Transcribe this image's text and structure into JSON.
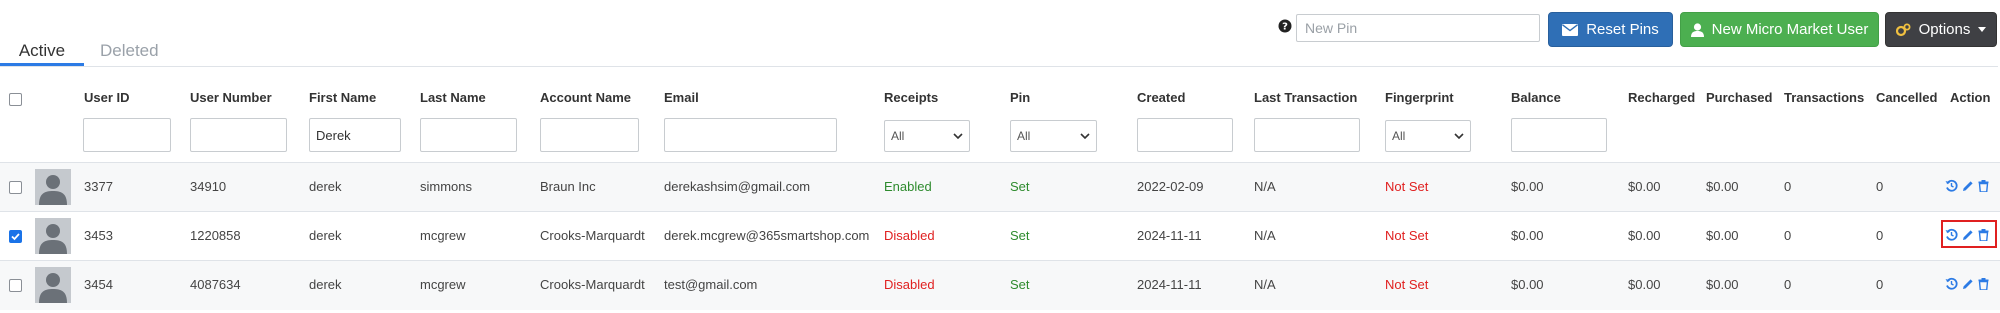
{
  "tabs": {
    "active": "Active",
    "deleted": "Deleted"
  },
  "toolbar": {
    "pin_placeholder": "New Pin",
    "reset_pins": "Reset Pins",
    "new_user": "New Micro Market User",
    "options": "Options"
  },
  "columns": {
    "user_id": "User ID",
    "user_number": "User Number",
    "first_name": "First Name",
    "last_name": "Last Name",
    "account_name": "Account Name",
    "email": "Email",
    "receipts": "Receipts",
    "pin": "Pin",
    "created": "Created",
    "last_transaction": "Last Transaction",
    "fingerprint": "Fingerprint",
    "balance": "Balance",
    "recharged": "Recharged",
    "purchased": "Purchased",
    "transactions": "Transactions",
    "cancelled": "Cancelled",
    "action": "Action"
  },
  "filters": {
    "first_name_value": "Derek",
    "receipts_select": "All",
    "pin_select": "All",
    "fingerprint_select": "All"
  },
  "rows": [
    {
      "checked": false,
      "user_id": "3377",
      "user_number": "34910",
      "first_name": "derek",
      "last_name": "simmons",
      "account_name": "Braun Inc",
      "email": "derekashsim@gmail.com",
      "receipts": "Enabled",
      "pin": "Set",
      "created": "2022-02-09",
      "last_transaction": "N/A",
      "fingerprint": "Not Set",
      "balance": "$0.00",
      "recharged": "$0.00",
      "purchased": "$0.00",
      "transactions": "0",
      "cancelled": "0"
    },
    {
      "checked": true,
      "user_id": "3453",
      "user_number": "1220858",
      "first_name": "derek",
      "last_name": "mcgrew",
      "account_name": "Crooks-Marquardt",
      "email": "derek.mcgrew@365smartshop.com",
      "receipts": "Disabled",
      "pin": "Set",
      "created": "2024-11-11",
      "last_transaction": "N/A",
      "fingerprint": "Not Set",
      "balance": "$0.00",
      "recharged": "$0.00",
      "purchased": "$0.00",
      "transactions": "0",
      "cancelled": "0"
    },
    {
      "checked": false,
      "user_id": "3454",
      "user_number": "4087634",
      "first_name": "derek",
      "last_name": "mcgrew",
      "account_name": "Crooks-Marquardt",
      "email": "test@gmail.com",
      "receipts": "Disabled",
      "pin": "Set",
      "created": "2024-11-11",
      "last_transaction": "N/A",
      "fingerprint": "Not Set",
      "balance": "$0.00",
      "recharged": "$0.00",
      "purchased": "$0.00",
      "transactions": "0",
      "cancelled": "0"
    }
  ],
  "colors": {
    "accent": "#2c7be5",
    "reset_button": "#2f6fb6",
    "new_user_button": "#4caf50",
    "options_button": "#3f4044",
    "enabled_green": "#2e8b2e",
    "alert_red": "#e02020"
  },
  "icons": {
    "help": "question-circle-icon",
    "reset": "envelope-icon",
    "new_user": "user-icon",
    "options": "gears-icon",
    "row_actions": [
      "history-icon",
      "pencil-icon",
      "trash-icon"
    ]
  }
}
